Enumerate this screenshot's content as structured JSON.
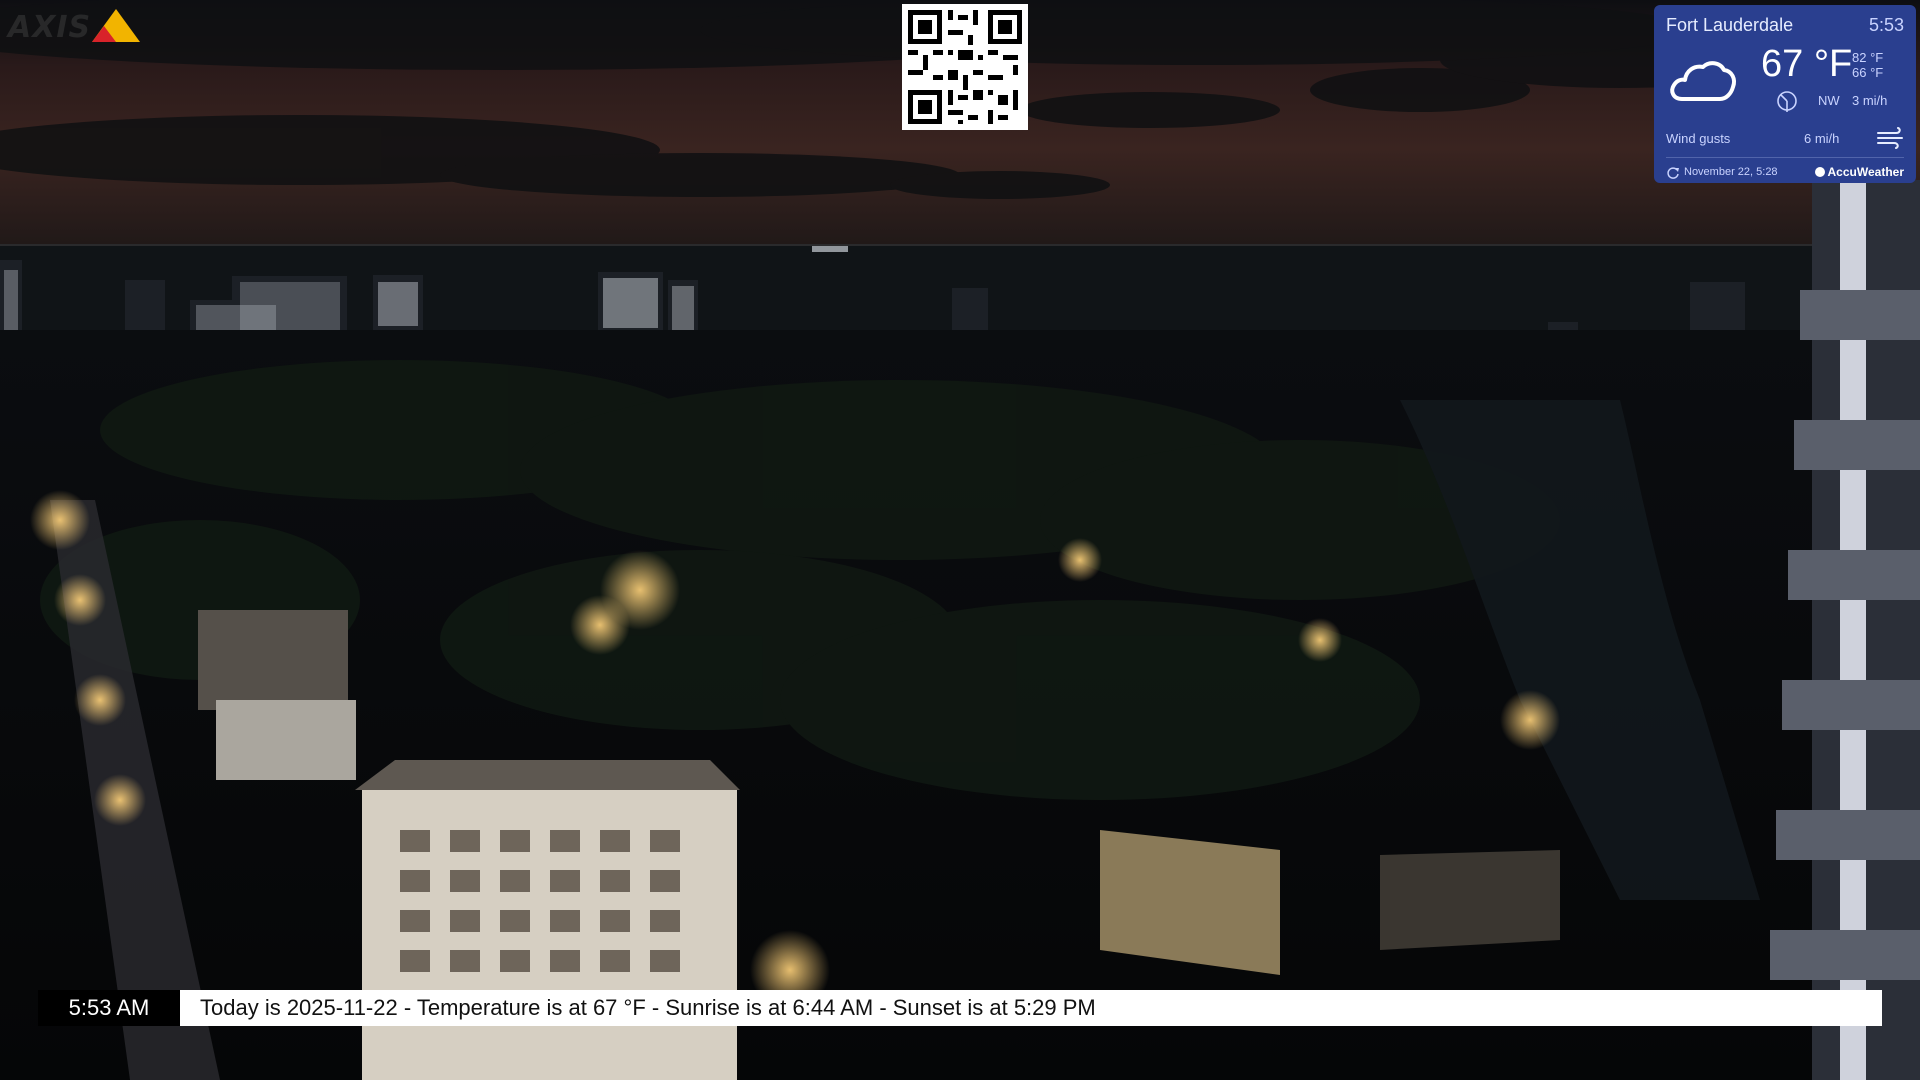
{
  "camera": {
    "logo_text": "AXIS"
  },
  "qr_code": {
    "icon": "qr-code-icon"
  },
  "weather": {
    "city": "Fort Lauderdale",
    "local_time": "5:53",
    "temperature": "67 °F",
    "high": "82 °F",
    "low": "66 °F",
    "condition_icon": "cloud-icon",
    "wind_direction": "NW",
    "wind_speed": "3 mi/h",
    "wind_gusts_label": "Wind gusts",
    "wind_gusts_value": "6 mi/h",
    "updated": "November 22, 5:28",
    "provider": "AccuWeather",
    "colors": {
      "panel": "#2a3f8f",
      "text": "#dfe6ff"
    }
  },
  "ticker": {
    "time": "5:53 AM",
    "message": "Today is 2025-11-22 - Temperature is at  67 °F - Sunrise is at 6:44 AM - Sunset is at 5:29 PM"
  }
}
